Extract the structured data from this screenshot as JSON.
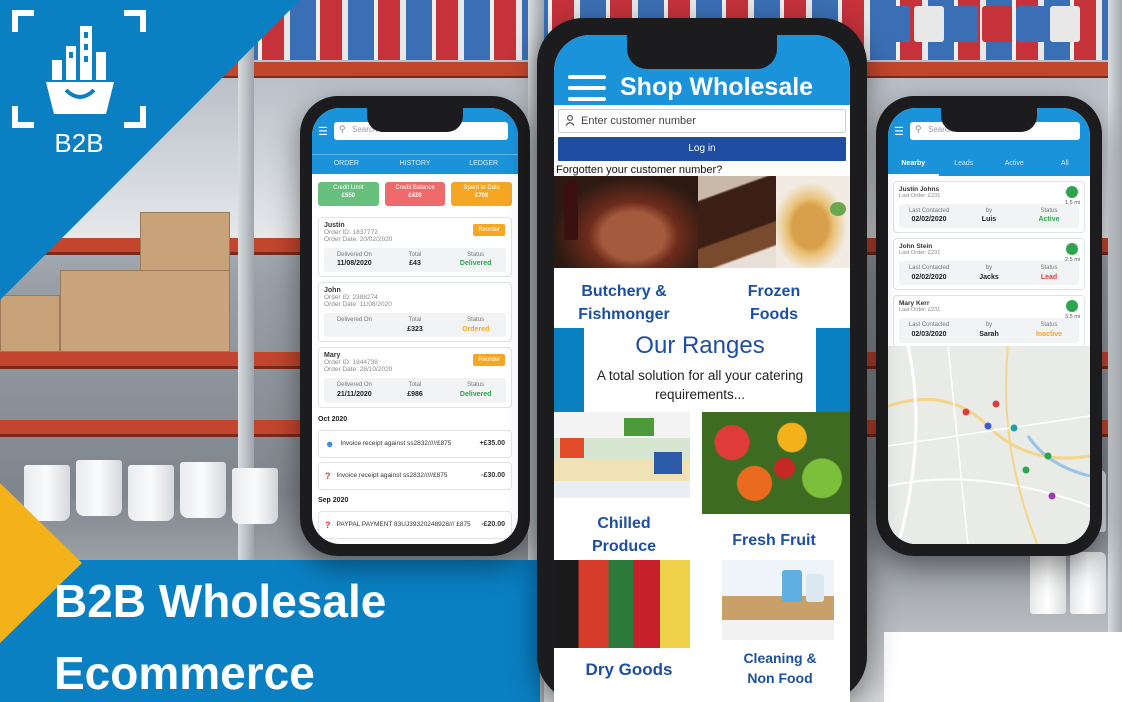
{
  "logo": {
    "label": "B2B"
  },
  "headline": {
    "line1": "B2B Wholesale",
    "line2": "Ecommerce"
  },
  "left_phone": {
    "search_placeholder": "Search",
    "tabs": [
      "ORDER",
      "HISTORY",
      "LEDGER"
    ],
    "stats": [
      {
        "label": "Credit Limit",
        "value": "£550",
        "color": "#67c17c"
      },
      {
        "label": "Credit Balance",
        "value": "£420",
        "color": "#ef6b6b"
      },
      {
        "label": "Spent to Date",
        "value": "£700",
        "color": "#f5a623"
      }
    ],
    "orders": [
      {
        "name": "Justin",
        "order_id": "Order ID: 1837772",
        "order_date": "Order Date: 20/02/2020",
        "reorder": "Reorder",
        "delivered_label": "Delivered On",
        "delivered": "11/08/2020",
        "total_label": "Total",
        "total": "£43",
        "status_label": "Status",
        "status": "Delivered"
      },
      {
        "name": "John",
        "order_id": "Order ID: 2388274",
        "order_date": "Order Date: 11/08/2020",
        "reorder": "",
        "delivered_label": "Delivered On",
        "delivered": "",
        "total_label": "Total",
        "total": "£323",
        "status_label": "Status",
        "status": "Ordered"
      },
      {
        "name": "Mary",
        "order_id": "Order ID: 1844738",
        "order_date": "Order Date: 28/10/2020",
        "reorder": "Reorder",
        "delivered_label": "Delivered On",
        "delivered": "21/11/2020",
        "total_label": "Total",
        "total": "£986",
        "status_label": "Status",
        "status": "Delivered"
      }
    ],
    "ledger_months": [
      {
        "month": "Oct 2020",
        "entries": [
          {
            "text": "Invoice receipt against ss2832/////£875",
            "amount": "+£35.00"
          },
          {
            "text": "Invoice receipt against ss2832/////£875",
            "amount": "-£30.00"
          }
        ]
      },
      {
        "month": "Sep 2020",
        "entries": [
          {
            "text": "PAYPAL PAYMENT 83UJ39320248928/// £875",
            "amount": "-£20.00"
          }
        ]
      }
    ]
  },
  "center_phone": {
    "title": "Shop Wholesale",
    "customer_placeholder": "Enter customer number",
    "login_label": "Log in",
    "forgot_text": "Forgotten your customer number?",
    "ranges_title": "Our Ranges",
    "ranges_subtitle_1": "A total solution for all your catering",
    "ranges_subtitle_2": "requirements...",
    "categories": [
      {
        "line1": "Butchery &",
        "line2": "Fishmonger"
      },
      {
        "line1": "Frozen",
        "line2": "Foods"
      },
      {
        "line1": "Chilled",
        "line2": "Produce"
      },
      {
        "line1": "Fresh Fruit",
        "line2": ""
      },
      {
        "line1": "Dry Goods",
        "line2": ""
      },
      {
        "line1": "Cleaning &",
        "line2": "Non Food"
      }
    ]
  },
  "right_phone": {
    "search_placeholder": "Search",
    "tabs": [
      "Nearby",
      "Leads",
      "Active",
      "All"
    ],
    "leads": [
      {
        "name": "Justin Johns",
        "last_order": "Last Order: £231",
        "dist": "1.5 mi",
        "contacted_label": "Last Contacted",
        "contacted": "02/02/2020",
        "by_label": "by",
        "by": "Luis",
        "status_label": "Status",
        "status": "Active"
      },
      {
        "name": "John Stein",
        "last_order": "Last Order: £231",
        "dist": "2.5 mi",
        "contacted_label": "Last Contacted",
        "contacted": "02/02/2020",
        "by_label": "by",
        "by": "Jacks",
        "status_label": "Status",
        "status": "Lead"
      },
      {
        "name": "Mary Kerr",
        "last_order": "Last Order: £231",
        "dist": "3.5 mi",
        "contacted_label": "Last Contacted",
        "contacted": "02/03/2020",
        "by_label": "by",
        "by": "Sarah",
        "status_label": "Status",
        "status": "Inactive"
      }
    ]
  },
  "colors": {
    "brand_blue": "#0a80c3",
    "header_blue": "#1b93da",
    "login_blue": "#1f4da1",
    "accent_yellow": "#f4b21a",
    "category_text": "#1d4fa0"
  }
}
